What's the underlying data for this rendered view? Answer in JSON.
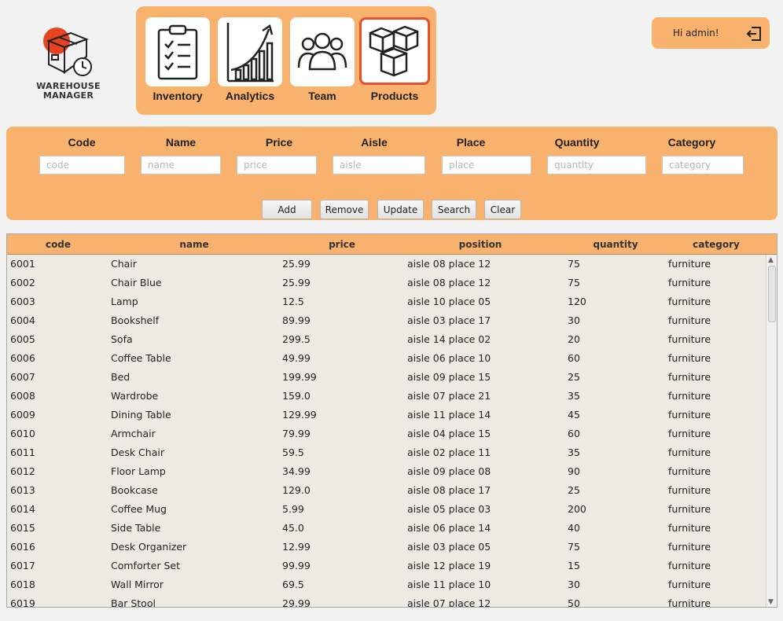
{
  "brand": {
    "line1": "WAREHOUSE",
    "line2": "MANAGER"
  },
  "nav": {
    "items": [
      {
        "label": "Inventory"
      },
      {
        "label": "Analytics"
      },
      {
        "label": "Team"
      },
      {
        "label": "Products"
      }
    ],
    "active": "Products"
  },
  "user": {
    "greeting": "Hi admin!"
  },
  "form": {
    "labels": {
      "code": "Code",
      "name": "Name",
      "price": "Price",
      "aisle": "Aisle",
      "place": "Place",
      "quantity": "Quantity",
      "category": "Category"
    },
    "placeholders": {
      "code": "code",
      "name": "name",
      "price": "price",
      "aisle": "aisle",
      "place": "place",
      "quantity": "quantity",
      "category": "category"
    },
    "buttons": {
      "add": "Add",
      "remove": "Remove",
      "update": "Update",
      "search": "Search",
      "clear": "Clear"
    }
  },
  "table": {
    "columns": [
      "code",
      "name",
      "price",
      "position",
      "quantity",
      "category"
    ],
    "rows": [
      [
        "6001",
        "Chair",
        "25.99",
        "aisle 08 place 12",
        "75",
        "furniture"
      ],
      [
        "6002",
        "Chair Blue",
        "25.99",
        "aisle 08 place 12",
        "75",
        "furniture"
      ],
      [
        "6003",
        "Lamp",
        "12.5",
        "aisle 10 place 05",
        "120",
        "furniture"
      ],
      [
        "6004",
        "Bookshelf",
        "89.99",
        "aisle 03 place 17",
        "30",
        "furniture"
      ],
      [
        "6005",
        "Sofa",
        "299.5",
        "aisle 14 place 02",
        "20",
        "furniture"
      ],
      [
        "6006",
        "Coffee Table",
        "49.99",
        "aisle 06 place 10",
        "60",
        "furniture"
      ],
      [
        "6007",
        "Bed",
        "199.99",
        "aisle 09 place 15",
        "25",
        "furniture"
      ],
      [
        "6008",
        "Wardrobe",
        "159.0",
        "aisle 07 place 21",
        "35",
        "furniture"
      ],
      [
        "6009",
        "Dining Table",
        "129.99",
        "aisle 11 place 14",
        "45",
        "furniture"
      ],
      [
        "6010",
        "Armchair",
        "79.99",
        "aisle 04 place 15",
        "60",
        "furniture"
      ],
      [
        "6011",
        "Desk Chair",
        "59.5",
        "aisle 02 place 11",
        "35",
        "furniture"
      ],
      [
        "6012",
        "Floor Lamp",
        "34.99",
        "aisle 09 place 08",
        "90",
        "furniture"
      ],
      [
        "6013",
        "Bookcase",
        "129.0",
        "aisle 08 place 17",
        "25",
        "furniture"
      ],
      [
        "6014",
        "Coffee Mug",
        "5.99",
        "aisle 05 place 03",
        "200",
        "furniture"
      ],
      [
        "6015",
        "Side Table",
        "45.0",
        "aisle 06 place 14",
        "40",
        "furniture"
      ],
      [
        "6016",
        "Desk Organizer",
        "12.99",
        "aisle 03 place 05",
        "75",
        "furniture"
      ],
      [
        "6017",
        "Comforter Set",
        "99.99",
        "aisle 12 place 19",
        "15",
        "furniture"
      ],
      [
        "6018",
        "Wall Mirror",
        "69.5",
        "aisle 11 place 10",
        "30",
        "furniture"
      ],
      [
        "6019",
        "Bar Stool",
        "29.99",
        "aisle 07 place 12",
        "50",
        "furniture"
      ]
    ]
  },
  "colors": {
    "accent": "#f9b16e",
    "active_border": "#e6502a",
    "table_bg": "#ecebe3"
  }
}
